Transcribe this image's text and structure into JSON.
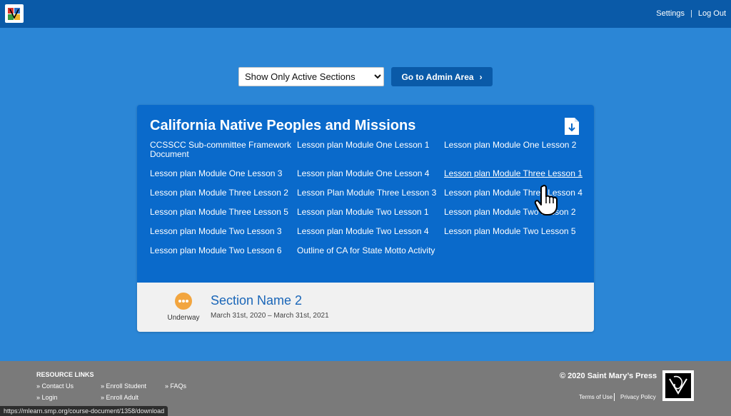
{
  "header": {
    "settings_label": "Settings",
    "separator": "|",
    "logout_label": "Log Out"
  },
  "controls": {
    "filter_selected": "Show Only Active Sections",
    "admin_button_label": "Go to Admin Area",
    "admin_button_chevron": "›"
  },
  "course": {
    "title": "California Native Peoples and Missions",
    "documents": [
      "CCSSCC Sub-committee Framework Document",
      "Lesson plan Module One Lesson 1",
      "Lesson plan Module One Lesson 2",
      "Lesson plan Module One Lesson 3",
      "Lesson plan Module One Lesson 4",
      "Lesson plan Module Three Lesson 1",
      "Lesson plan Module Three Lesson 2",
      "Lesson Plan Module Three Lesson 3",
      "Lesson plan Module Three Lesson 4",
      "Lesson plan Module Three Lesson 5",
      "Lesson plan Module Two Lesson 1",
      "Lesson plan Module Two Lesson 2",
      "Lesson plan Module Two Lesson 3",
      "Lesson plan Module Two Lesson 4",
      "Lesson plan Module Two Lesson 5",
      "Lesson plan Module Two Lesson 6",
      "Outline of CA for State Motto Activity"
    ]
  },
  "section": {
    "status": "Underway",
    "name": "Section Name 2",
    "dates": "March 31st, 2020 – March 31st, 2021"
  },
  "footer": {
    "resource_title": "RESOURCE LINKS",
    "links": {
      "contact": "» Contact Us",
      "login": "» Login",
      "enroll_student": "» Enroll Student",
      "enroll_adult": "» Enroll Adult",
      "faqs": "» FAQs"
    },
    "copyright": "© 2020 Saint Mary’s Press",
    "terms": "Terms of Use",
    "privacy": "Privacy Policy"
  },
  "statusbar": {
    "url": "https://mlearn.smp.org/course-document/1358/download"
  },
  "colors": {
    "background": "#2b86d6",
    "header": "#0a5aa8",
    "card": "#0a6acb",
    "status_underway": "#f2a53f",
    "footer": "#7a7a7a"
  }
}
